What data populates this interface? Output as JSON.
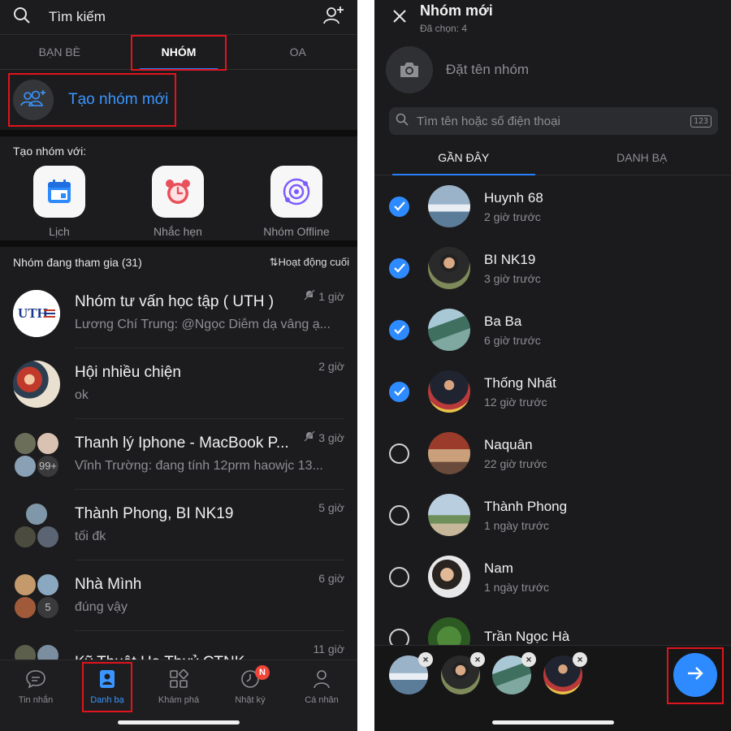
{
  "left": {
    "search_placeholder": "Tìm kiếm",
    "tabs": [
      {
        "label": "BẠN BÈ"
      },
      {
        "label": "NHÓM"
      },
      {
        "label": "OA"
      }
    ],
    "create_group_label": "Tạo nhóm mới",
    "create_with_title": "Tạo nhóm với:",
    "create_with_items": [
      {
        "label": "Lịch",
        "icon": "calendar-icon"
      },
      {
        "label": "Nhắc hẹn",
        "icon": "alarm-clock-icon"
      },
      {
        "label": "Nhóm Offline",
        "icon": "orbit-icon"
      }
    ],
    "joined_title": "Nhóm đang tham gia (31)",
    "sort_label": "Hoạt động cuối",
    "groups": [
      {
        "name": "Nhóm tư vấn học tập ( UTH )",
        "message": "Lương Chí Trung: @Ngọc Diễm dạ vâng ạ...",
        "time": "1 giờ",
        "muted": true
      },
      {
        "name": "Hội nhiều chiện",
        "message": "ok",
        "time": "2 giờ",
        "muted": false
      },
      {
        "name": "Thanh lý Iphone - MacBook P...",
        "message": "Vĩnh Trường: đang tính 12prm haowjc 13...",
        "time": "3 giờ",
        "muted": true,
        "count": "99+"
      },
      {
        "name": "Thành Phong, BI NK19",
        "message": "tối đk",
        "time": "5 giờ",
        "muted": false
      },
      {
        "name": "Nhà Mình",
        "message": "đúng vậy",
        "time": "6 giờ",
        "muted": false,
        "count": "5"
      },
      {
        "name": "Kỹ Thuật Ha Thuỷ CTNK",
        "message": "",
        "time": "11 giờ",
        "muted": false
      }
    ],
    "nav": [
      {
        "label": "Tin nhắn",
        "icon": "chat-bubble-icon"
      },
      {
        "label": "Danh bạ",
        "icon": "contact-card-icon"
      },
      {
        "label": "Khám phá",
        "icon": "grid-icon"
      },
      {
        "label": "Nhật ký",
        "icon": "clock-icon",
        "badge": "N"
      },
      {
        "label": "Cá nhân",
        "icon": "person-icon"
      }
    ],
    "uth_logo_text": "UTH"
  },
  "right": {
    "title": "Nhóm mới",
    "subtitle": "Đã chọn: 4",
    "name_placeholder": "Đặt tên nhóm",
    "search_placeholder": "Tìm tên hoặc số điện thoại",
    "keypad_label": "123",
    "tabs": [
      {
        "label": "GẦN ĐÂY"
      },
      {
        "label": "DANH BẠ"
      }
    ],
    "contacts": [
      {
        "name": "Huynh 68",
        "sub": "2 giờ trước",
        "checked": true
      },
      {
        "name": "BI NK19",
        "sub": "3 giờ trước",
        "checked": true
      },
      {
        "name": "Ba Ba",
        "sub": "6 giờ trước",
        "checked": true
      },
      {
        "name": "Thống Nhất",
        "sub": "12 giờ trước",
        "checked": true
      },
      {
        "name": "Naquân",
        "sub": "22 giờ trước",
        "checked": false
      },
      {
        "name": "Thành Phong",
        "sub": "1 ngày trước",
        "checked": false
      },
      {
        "name": "Nam",
        "sub": "1 ngày trước",
        "checked": false
      },
      {
        "name": "Trần Ngọc Hà",
        "sub": "",
        "checked": false
      }
    ]
  },
  "colors": {
    "accent_blue": "#2e8bff",
    "highlight_red": "#e0141e",
    "background": "#1c1c1e"
  }
}
